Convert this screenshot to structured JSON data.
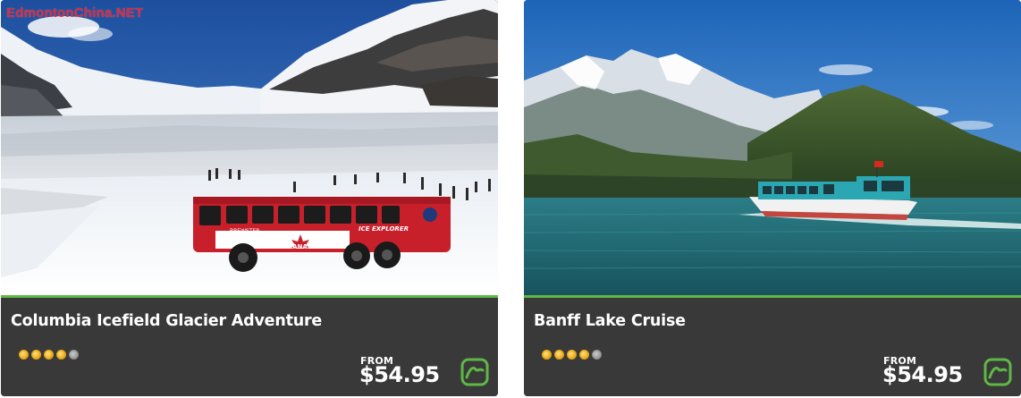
{
  "watermark": "EdmontonChina.NET",
  "cards": [
    {
      "title": "Columbia Icefield Glacier Adventure",
      "photo_description": "Red Ice Explorer bus on glacier with snowy mountains",
      "bus_text_left": "BREWSTER",
      "bus_text_right": "ICE EXPLORER",
      "bus_text_flag": "CANADA",
      "rating": {
        "value": 4,
        "max": 5
      },
      "price_prefix": "FROM",
      "price": "$54.95",
      "badge_icon": "mountain-badge-icon"
    },
    {
      "title": "Banff Lake Cruise",
      "photo_description": "Tour boat cruising on Lake Minnewanka below mountains",
      "rating": {
        "value": 4,
        "max": 5
      },
      "price_prefix": "FROM",
      "price": "$54.95",
      "badge_icon": "mountain-badge-icon"
    }
  ],
  "colors": {
    "card_background": "#393939",
    "accent_green": "#5fb846",
    "star_gold": "#f2b01e",
    "star_empty": "#9a9a9a",
    "watermark_red": "#e2283a"
  }
}
